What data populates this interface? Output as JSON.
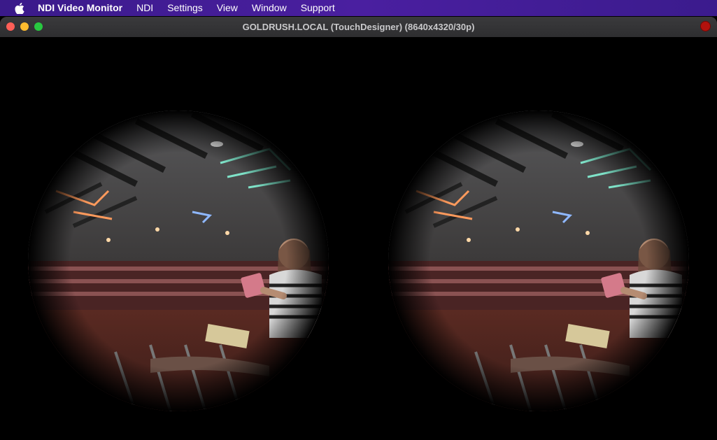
{
  "menubar": {
    "apple_icon": "apple-icon",
    "app_name": "NDI Video Monitor",
    "items": [
      "NDI",
      "Settings",
      "View",
      "Window",
      "Support"
    ]
  },
  "window": {
    "title": "GOLDRUSH.LOCAL (TouchDesigner) (8640x4320/30p)",
    "record_indicator_color": "#b3120d"
  }
}
